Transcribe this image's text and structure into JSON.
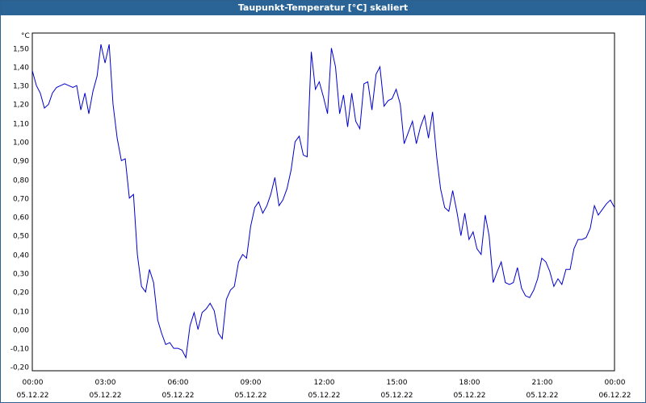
{
  "window": {
    "title": "Taupunkt-Temperatur [°C] skaliert"
  },
  "colors": {
    "titlebar": "#2a6496",
    "line": "#0000cc",
    "grid": "#000000"
  },
  "chart_data": {
    "type": "line",
    "title": "Taupunkt-Temperatur [°C] skaliert",
    "ylabel": "°C",
    "xlabel": "",
    "ylim": [
      -0.22,
      1.58
    ],
    "xlim_hours": [
      0,
      24
    ],
    "grid": true,
    "y_ticks": [
      "-0,20",
      "-0,10",
      "0,00",
      "0,10",
      "0,20",
      "0,30",
      "0,40",
      "0,50",
      "0,60",
      "0,70",
      "0,80",
      "0,90",
      "1,00",
      "1,10",
      "1,20",
      "1,30",
      "1,40",
      "1,50"
    ],
    "y_tick_values": [
      -0.2,
      -0.1,
      0.0,
      0.1,
      0.2,
      0.3,
      0.4,
      0.5,
      0.6,
      0.7,
      0.8,
      0.9,
      1.0,
      1.1,
      1.2,
      1.3,
      1.4,
      1.5
    ],
    "x_ticks": [
      {
        "time": "00:00",
        "date": "05.12.22"
      },
      {
        "time": "03:00",
        "date": "05.12.22"
      },
      {
        "time": "06:00",
        "date": "05.12.22"
      },
      {
        "time": "09:00",
        "date": "05.12.22"
      },
      {
        "time": "12:00",
        "date": "05.12.22"
      },
      {
        "time": "15:00",
        "date": "05.12.22"
      },
      {
        "time": "18:00",
        "date": "05.12.22"
      },
      {
        "time": "21:00",
        "date": "05.12.22"
      },
      {
        "time": "00:00",
        "date": "06.12.22"
      }
    ],
    "x_tick_hours": [
      0,
      3,
      6,
      9,
      12,
      15,
      18,
      21,
      24
    ],
    "series": [
      {
        "values": [
          [
            0.0,
            1.38
          ],
          [
            0.17,
            1.3
          ],
          [
            0.33,
            1.26
          ],
          [
            0.5,
            1.18
          ],
          [
            0.67,
            1.2
          ],
          [
            0.83,
            1.26
          ],
          [
            1.0,
            1.29
          ],
          [
            1.17,
            1.3
          ],
          [
            1.33,
            1.31
          ],
          [
            1.5,
            1.3
          ],
          [
            1.67,
            1.29
          ],
          [
            1.83,
            1.3
          ],
          [
            2.0,
            1.17
          ],
          [
            2.17,
            1.26
          ],
          [
            2.33,
            1.15
          ],
          [
            2.5,
            1.27
          ],
          [
            2.67,
            1.35
          ],
          [
            2.83,
            1.52
          ],
          [
            3.0,
            1.42
          ],
          [
            3.17,
            1.52
          ],
          [
            3.33,
            1.2
          ],
          [
            3.5,
            1.02
          ],
          [
            3.67,
            0.9
          ],
          [
            3.83,
            0.91
          ],
          [
            4.0,
            0.7
          ],
          [
            4.17,
            0.72
          ],
          [
            4.33,
            0.4
          ],
          [
            4.5,
            0.23
          ],
          [
            4.67,
            0.2
          ],
          [
            4.83,
            0.32
          ],
          [
            5.0,
            0.25
          ],
          [
            5.17,
            0.05
          ],
          [
            5.33,
            -0.02
          ],
          [
            5.5,
            -0.08
          ],
          [
            5.67,
            -0.07
          ],
          [
            5.83,
            -0.1
          ],
          [
            6.0,
            -0.1
          ],
          [
            6.17,
            -0.11
          ],
          [
            6.33,
            -0.15
          ],
          [
            6.5,
            0.02
          ],
          [
            6.67,
            0.09
          ],
          [
            6.83,
            0.0
          ],
          [
            7.0,
            0.09
          ],
          [
            7.17,
            0.11
          ],
          [
            7.33,
            0.14
          ],
          [
            7.5,
            0.1
          ],
          [
            7.67,
            -0.02
          ],
          [
            7.83,
            -0.05
          ],
          [
            8.0,
            0.16
          ],
          [
            8.17,
            0.21
          ],
          [
            8.33,
            0.23
          ],
          [
            8.5,
            0.36
          ],
          [
            8.67,
            0.4
          ],
          [
            8.83,
            0.38
          ],
          [
            9.0,
            0.55
          ],
          [
            9.17,
            0.65
          ],
          [
            9.33,
            0.68
          ],
          [
            9.5,
            0.62
          ],
          [
            9.67,
            0.66
          ],
          [
            9.83,
            0.72
          ],
          [
            10.0,
            0.81
          ],
          [
            10.17,
            0.66
          ],
          [
            10.33,
            0.69
          ],
          [
            10.5,
            0.75
          ],
          [
            10.67,
            0.85
          ],
          [
            10.83,
            1.0
          ],
          [
            11.0,
            1.03
          ],
          [
            11.17,
            0.93
          ],
          [
            11.33,
            0.92
          ],
          [
            11.5,
            1.48
          ],
          [
            11.67,
            1.28
          ],
          [
            11.83,
            1.32
          ],
          [
            12.0,
            1.24
          ],
          [
            12.17,
            1.15
          ],
          [
            12.33,
            1.5
          ],
          [
            12.5,
            1.4
          ],
          [
            12.67,
            1.15
          ],
          [
            12.83,
            1.25
          ],
          [
            13.0,
            1.08
          ],
          [
            13.17,
            1.26
          ],
          [
            13.33,
            1.11
          ],
          [
            13.5,
            1.07
          ],
          [
            13.67,
            1.31
          ],
          [
            13.83,
            1.32
          ],
          [
            14.0,
            1.17
          ],
          [
            14.17,
            1.36
          ],
          [
            14.33,
            1.4
          ],
          [
            14.5,
            1.19
          ],
          [
            14.67,
            1.22
          ],
          [
            14.83,
            1.23
          ],
          [
            15.0,
            1.28
          ],
          [
            15.17,
            1.2
          ],
          [
            15.33,
            0.99
          ],
          [
            15.5,
            1.05
          ],
          [
            15.67,
            1.11
          ],
          [
            15.83,
            0.99
          ],
          [
            16.0,
            1.08
          ],
          [
            16.17,
            1.14
          ],
          [
            16.33,
            1.02
          ],
          [
            16.5,
            1.16
          ],
          [
            16.67,
            0.92
          ],
          [
            16.83,
            0.75
          ],
          [
            17.0,
            0.65
          ],
          [
            17.17,
            0.63
          ],
          [
            17.33,
            0.74
          ],
          [
            17.5,
            0.63
          ],
          [
            17.67,
            0.5
          ],
          [
            17.83,
            0.62
          ],
          [
            18.0,
            0.48
          ],
          [
            18.17,
            0.52
          ],
          [
            18.33,
            0.43
          ],
          [
            18.5,
            0.4
          ],
          [
            18.67,
            0.61
          ],
          [
            18.83,
            0.5
          ],
          [
            19.0,
            0.25
          ],
          [
            19.17,
            0.31
          ],
          [
            19.33,
            0.36
          ],
          [
            19.5,
            0.25
          ],
          [
            19.67,
            0.24
          ],
          [
            19.83,
            0.25
          ],
          [
            20.0,
            0.33
          ],
          [
            20.17,
            0.22
          ],
          [
            20.33,
            0.18
          ],
          [
            20.5,
            0.17
          ],
          [
            20.67,
            0.21
          ],
          [
            20.83,
            0.27
          ],
          [
            21.0,
            0.38
          ],
          [
            21.17,
            0.36
          ],
          [
            21.33,
            0.31
          ],
          [
            21.5,
            0.23
          ],
          [
            21.67,
            0.27
          ],
          [
            21.83,
            0.24
          ],
          [
            22.0,
            0.32
          ],
          [
            22.17,
            0.32
          ],
          [
            22.33,
            0.43
          ],
          [
            22.5,
            0.48
          ],
          [
            22.67,
            0.48
          ],
          [
            22.83,
            0.49
          ],
          [
            23.0,
            0.54
          ],
          [
            23.17,
            0.66
          ],
          [
            23.33,
            0.61
          ],
          [
            23.5,
            0.64
          ],
          [
            23.67,
            0.67
          ],
          [
            23.83,
            0.69
          ],
          [
            24.0,
            0.65
          ]
        ]
      }
    ]
  }
}
